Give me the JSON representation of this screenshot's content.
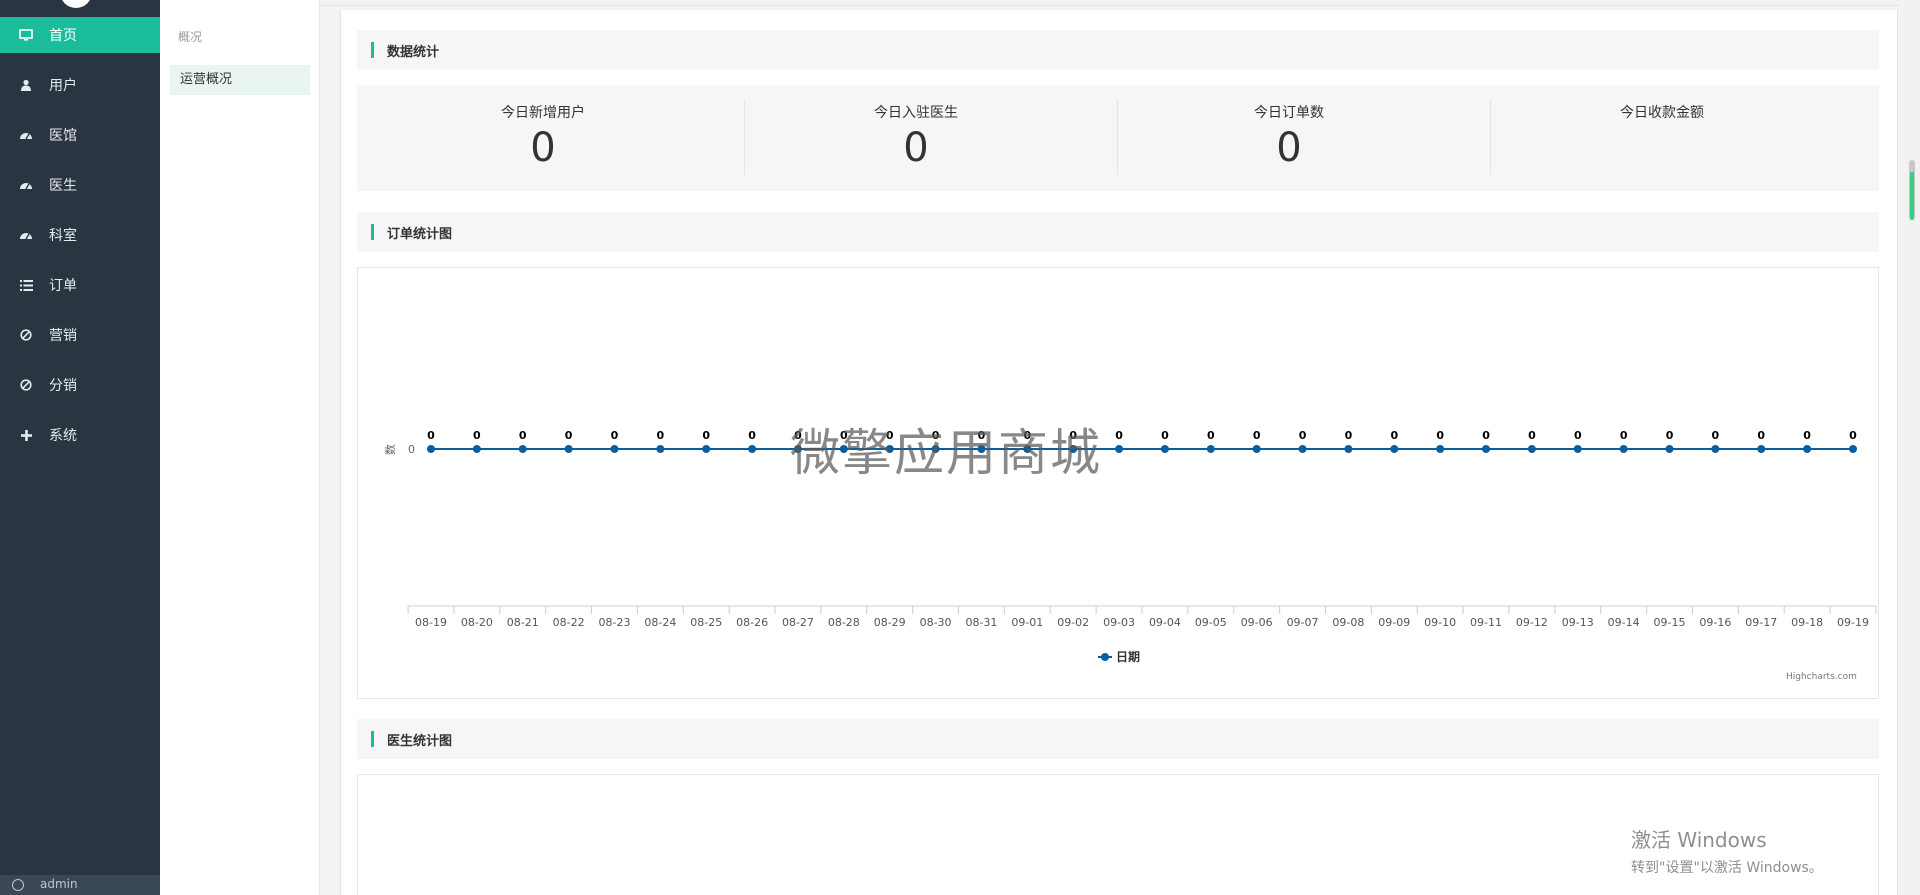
{
  "sidebar": {
    "items": [
      {
        "label": "首页",
        "icon": "monitor-icon"
      },
      {
        "label": "用户",
        "icon": "user-icon"
      },
      {
        "label": "医馆",
        "icon": "dashboard-icon"
      },
      {
        "label": "医生",
        "icon": "dashboard-icon"
      },
      {
        "label": "科室",
        "icon": "dashboard-icon"
      },
      {
        "label": "订单",
        "icon": "list-icon"
      },
      {
        "label": "营销",
        "icon": "ban-icon"
      },
      {
        "label": "分销",
        "icon": "ban-icon"
      },
      {
        "label": "系统",
        "icon": "plus-icon"
      }
    ],
    "active_index": 0,
    "bottom_text": "admin"
  },
  "subnav": {
    "title": "概况",
    "item": "运营概况"
  },
  "sections": {
    "data_stats": "数据统计",
    "order_chart": "订单统计图",
    "doctor_chart": "医生统计图"
  },
  "stats": [
    {
      "label": "今日新增用户",
      "value": "0"
    },
    {
      "label": "今日入驻医生",
      "value": "0"
    },
    {
      "label": "今日订单数",
      "value": "0"
    },
    {
      "label": "今日收款金额",
      "value": ""
    }
  ],
  "chart_data": {
    "type": "line",
    "categories": [
      "08-19",
      "08-20",
      "08-21",
      "08-22",
      "08-23",
      "08-24",
      "08-25",
      "08-26",
      "08-27",
      "08-28",
      "08-29",
      "08-30",
      "08-31",
      "09-01",
      "09-02",
      "09-03",
      "09-04",
      "09-05",
      "09-06",
      "09-07",
      "09-08",
      "09-09",
      "09-10",
      "09-11",
      "09-12",
      "09-13",
      "09-14",
      "09-15",
      "09-16",
      "09-17",
      "09-18",
      "09-19"
    ],
    "series": [
      {
        "name": "日期",
        "values": [
          0,
          0,
          0,
          0,
          0,
          0,
          0,
          0,
          0,
          0,
          0,
          0,
          0,
          0,
          0,
          0,
          0,
          0,
          0,
          0,
          0,
          0,
          0,
          0,
          0,
          0,
          0,
          0,
          0,
          0,
          0,
          0
        ]
      }
    ],
    "ylabel": "数",
    "yticks": [
      "0"
    ],
    "data_labels": true,
    "legend": "bottom-center",
    "credit": "Highcharts.com",
    "color": "#0a5fa0"
  },
  "watermark": "微擎应用商城",
  "windows_activation": {
    "line1": "激活 Windows",
    "line2": "转到\"设置\"以激活 Windows。"
  },
  "colors": {
    "accent": "#1abc9c",
    "sidebar_bg": "#2a3542"
  }
}
